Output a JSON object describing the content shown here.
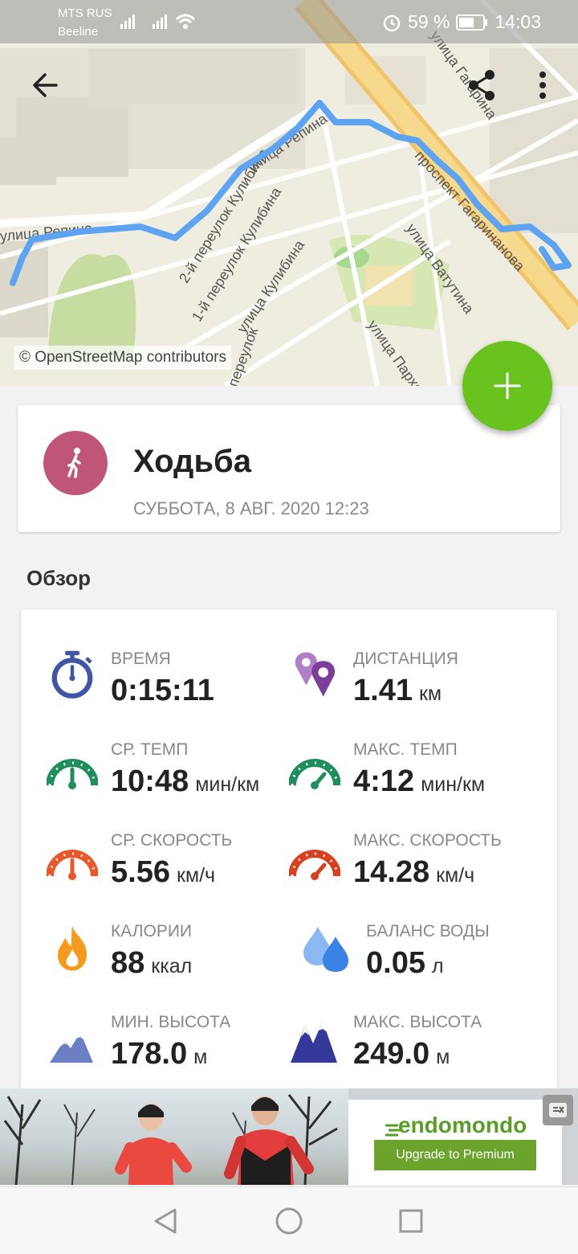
{
  "status_bar": {
    "carrier1": "MTS RUS",
    "carrier2": "Beeline",
    "battery": "59 %",
    "time": "14:03"
  },
  "map": {
    "attribution": "© OpenStreetMap contributors",
    "street_labels": [
      "улица Репина",
      "улица Репина",
      "2-й переулок Кулибина",
      "1-й переулок Кулибина",
      "улица Кулибина",
      "улица Ватутина",
      "улица Пархоменко",
      "переулок",
      "улица Гагарина",
      "проспект Гагаринанова"
    ],
    "route_color": "#5ea3f2"
  },
  "toolbar": {
    "back_icon": "arrow-left-icon",
    "share_icon": "share-icon",
    "menu_icon": "more-vertical-icon"
  },
  "fab": {
    "icon": "plus-icon",
    "color": "#6ac21f"
  },
  "workout": {
    "sport": "Ходьба",
    "date": "СУББОТА, 8 АВГ. 2020 12:23",
    "sport_color": "#c05677"
  },
  "overview": {
    "title": "Обзор",
    "stats": [
      {
        "label": "ВРЕМЯ",
        "value": "0:15:11",
        "unit": "",
        "icon": "stopwatch-icon"
      },
      {
        "label": "ДИСТАНЦИЯ",
        "value": "1.41",
        "unit": "км",
        "icon": "map-pin-icon"
      },
      {
        "label": "СР. ТЕМП",
        "value": "10:48",
        "unit": "мин/км",
        "icon": "avg-pace-gauge-icon"
      },
      {
        "label": "МАКС. ТЕМП",
        "value": "4:12",
        "unit": "мин/км",
        "icon": "max-pace-gauge-icon"
      },
      {
        "label": "СР. СКОРОСТЬ",
        "value": "5.56",
        "unit": "км/ч",
        "icon": "avg-speed-gauge-icon"
      },
      {
        "label": "МАКС. СКОРОСТЬ",
        "value": "14.28",
        "unit": "км/ч",
        "icon": "max-speed-gauge-icon"
      },
      {
        "label": "КАЛОРИИ",
        "value": "88",
        "unit": "ккал",
        "icon": "flame-icon"
      },
      {
        "label": "БАЛАНС ВОДЫ",
        "value": "0.05",
        "unit": "л",
        "icon": "water-drops-icon"
      },
      {
        "label": "МИН. ВЫСОТА",
        "value": "178.0",
        "unit": "м",
        "icon": "mountain-low-icon"
      },
      {
        "label": "МАКС. ВЫСОТА",
        "value": "249.0",
        "unit": "м",
        "icon": "mountain-high-icon"
      }
    ]
  },
  "ad": {
    "brand": "endomondo",
    "cta": "Upgrade to Premium",
    "close_icon": "ad-close-icon"
  },
  "nav": {
    "back_icon": "nav-back-icon",
    "home_icon": "nav-home-icon",
    "recents_icon": "nav-recents-icon"
  }
}
